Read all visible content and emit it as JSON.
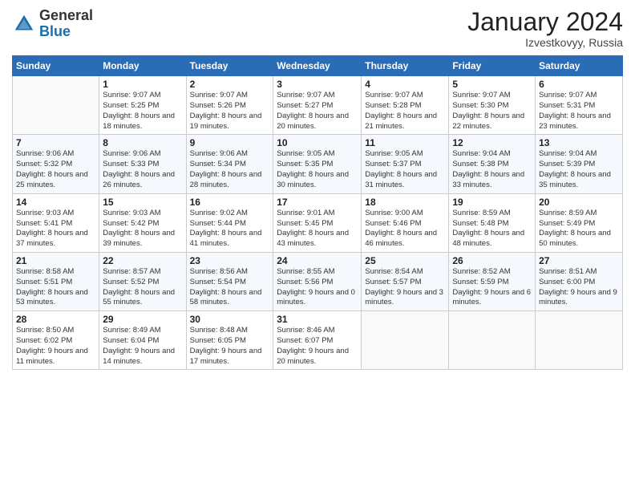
{
  "header": {
    "logo_general": "General",
    "logo_blue": "Blue",
    "month_title": "January 2024",
    "location": "Izvestkovyy, Russia"
  },
  "columns": [
    "Sunday",
    "Monday",
    "Tuesday",
    "Wednesday",
    "Thursday",
    "Friday",
    "Saturday"
  ],
  "weeks": [
    [
      {
        "day": "",
        "sunrise": "",
        "sunset": "",
        "daylight": ""
      },
      {
        "day": "1",
        "sunrise": "Sunrise: 9:07 AM",
        "sunset": "Sunset: 5:25 PM",
        "daylight": "Daylight: 8 hours and 18 minutes."
      },
      {
        "day": "2",
        "sunrise": "Sunrise: 9:07 AM",
        "sunset": "Sunset: 5:26 PM",
        "daylight": "Daylight: 8 hours and 19 minutes."
      },
      {
        "day": "3",
        "sunrise": "Sunrise: 9:07 AM",
        "sunset": "Sunset: 5:27 PM",
        "daylight": "Daylight: 8 hours and 20 minutes."
      },
      {
        "day": "4",
        "sunrise": "Sunrise: 9:07 AM",
        "sunset": "Sunset: 5:28 PM",
        "daylight": "Daylight: 8 hours and 21 minutes."
      },
      {
        "day": "5",
        "sunrise": "Sunrise: 9:07 AM",
        "sunset": "Sunset: 5:30 PM",
        "daylight": "Daylight: 8 hours and 22 minutes."
      },
      {
        "day": "6",
        "sunrise": "Sunrise: 9:07 AM",
        "sunset": "Sunset: 5:31 PM",
        "daylight": "Daylight: 8 hours and 23 minutes."
      }
    ],
    [
      {
        "day": "7",
        "sunrise": "Sunrise: 9:06 AM",
        "sunset": "Sunset: 5:32 PM",
        "daylight": "Daylight: 8 hours and 25 minutes."
      },
      {
        "day": "8",
        "sunrise": "Sunrise: 9:06 AM",
        "sunset": "Sunset: 5:33 PM",
        "daylight": "Daylight: 8 hours and 26 minutes."
      },
      {
        "day": "9",
        "sunrise": "Sunrise: 9:06 AM",
        "sunset": "Sunset: 5:34 PM",
        "daylight": "Daylight: 8 hours and 28 minutes."
      },
      {
        "day": "10",
        "sunrise": "Sunrise: 9:05 AM",
        "sunset": "Sunset: 5:35 PM",
        "daylight": "Daylight: 8 hours and 30 minutes."
      },
      {
        "day": "11",
        "sunrise": "Sunrise: 9:05 AM",
        "sunset": "Sunset: 5:37 PM",
        "daylight": "Daylight: 8 hours and 31 minutes."
      },
      {
        "day": "12",
        "sunrise": "Sunrise: 9:04 AM",
        "sunset": "Sunset: 5:38 PM",
        "daylight": "Daylight: 8 hours and 33 minutes."
      },
      {
        "day": "13",
        "sunrise": "Sunrise: 9:04 AM",
        "sunset": "Sunset: 5:39 PM",
        "daylight": "Daylight: 8 hours and 35 minutes."
      }
    ],
    [
      {
        "day": "14",
        "sunrise": "Sunrise: 9:03 AM",
        "sunset": "Sunset: 5:41 PM",
        "daylight": "Daylight: 8 hours and 37 minutes."
      },
      {
        "day": "15",
        "sunrise": "Sunrise: 9:03 AM",
        "sunset": "Sunset: 5:42 PM",
        "daylight": "Daylight: 8 hours and 39 minutes."
      },
      {
        "day": "16",
        "sunrise": "Sunrise: 9:02 AM",
        "sunset": "Sunset: 5:44 PM",
        "daylight": "Daylight: 8 hours and 41 minutes."
      },
      {
        "day": "17",
        "sunrise": "Sunrise: 9:01 AM",
        "sunset": "Sunset: 5:45 PM",
        "daylight": "Daylight: 8 hours and 43 minutes."
      },
      {
        "day": "18",
        "sunrise": "Sunrise: 9:00 AM",
        "sunset": "Sunset: 5:46 PM",
        "daylight": "Daylight: 8 hours and 46 minutes."
      },
      {
        "day": "19",
        "sunrise": "Sunrise: 8:59 AM",
        "sunset": "Sunset: 5:48 PM",
        "daylight": "Daylight: 8 hours and 48 minutes."
      },
      {
        "day": "20",
        "sunrise": "Sunrise: 8:59 AM",
        "sunset": "Sunset: 5:49 PM",
        "daylight": "Daylight: 8 hours and 50 minutes."
      }
    ],
    [
      {
        "day": "21",
        "sunrise": "Sunrise: 8:58 AM",
        "sunset": "Sunset: 5:51 PM",
        "daylight": "Daylight: 8 hours and 53 minutes."
      },
      {
        "day": "22",
        "sunrise": "Sunrise: 8:57 AM",
        "sunset": "Sunset: 5:52 PM",
        "daylight": "Daylight: 8 hours and 55 minutes."
      },
      {
        "day": "23",
        "sunrise": "Sunrise: 8:56 AM",
        "sunset": "Sunset: 5:54 PM",
        "daylight": "Daylight: 8 hours and 58 minutes."
      },
      {
        "day": "24",
        "sunrise": "Sunrise: 8:55 AM",
        "sunset": "Sunset: 5:56 PM",
        "daylight": "Daylight: 9 hours and 0 minutes."
      },
      {
        "day": "25",
        "sunrise": "Sunrise: 8:54 AM",
        "sunset": "Sunset: 5:57 PM",
        "daylight": "Daylight: 9 hours and 3 minutes."
      },
      {
        "day": "26",
        "sunrise": "Sunrise: 8:52 AM",
        "sunset": "Sunset: 5:59 PM",
        "daylight": "Daylight: 9 hours and 6 minutes."
      },
      {
        "day": "27",
        "sunrise": "Sunrise: 8:51 AM",
        "sunset": "Sunset: 6:00 PM",
        "daylight": "Daylight: 9 hours and 9 minutes."
      }
    ],
    [
      {
        "day": "28",
        "sunrise": "Sunrise: 8:50 AM",
        "sunset": "Sunset: 6:02 PM",
        "daylight": "Daylight: 9 hours and 11 minutes."
      },
      {
        "day": "29",
        "sunrise": "Sunrise: 8:49 AM",
        "sunset": "Sunset: 6:04 PM",
        "daylight": "Daylight: 9 hours and 14 minutes."
      },
      {
        "day": "30",
        "sunrise": "Sunrise: 8:48 AM",
        "sunset": "Sunset: 6:05 PM",
        "daylight": "Daylight: 9 hours and 17 minutes."
      },
      {
        "day": "31",
        "sunrise": "Sunrise: 8:46 AM",
        "sunset": "Sunset: 6:07 PM",
        "daylight": "Daylight: 9 hours and 20 minutes."
      },
      {
        "day": "",
        "sunrise": "",
        "sunset": "",
        "daylight": ""
      },
      {
        "day": "",
        "sunrise": "",
        "sunset": "",
        "daylight": ""
      },
      {
        "day": "",
        "sunrise": "",
        "sunset": "",
        "daylight": ""
      }
    ]
  ]
}
